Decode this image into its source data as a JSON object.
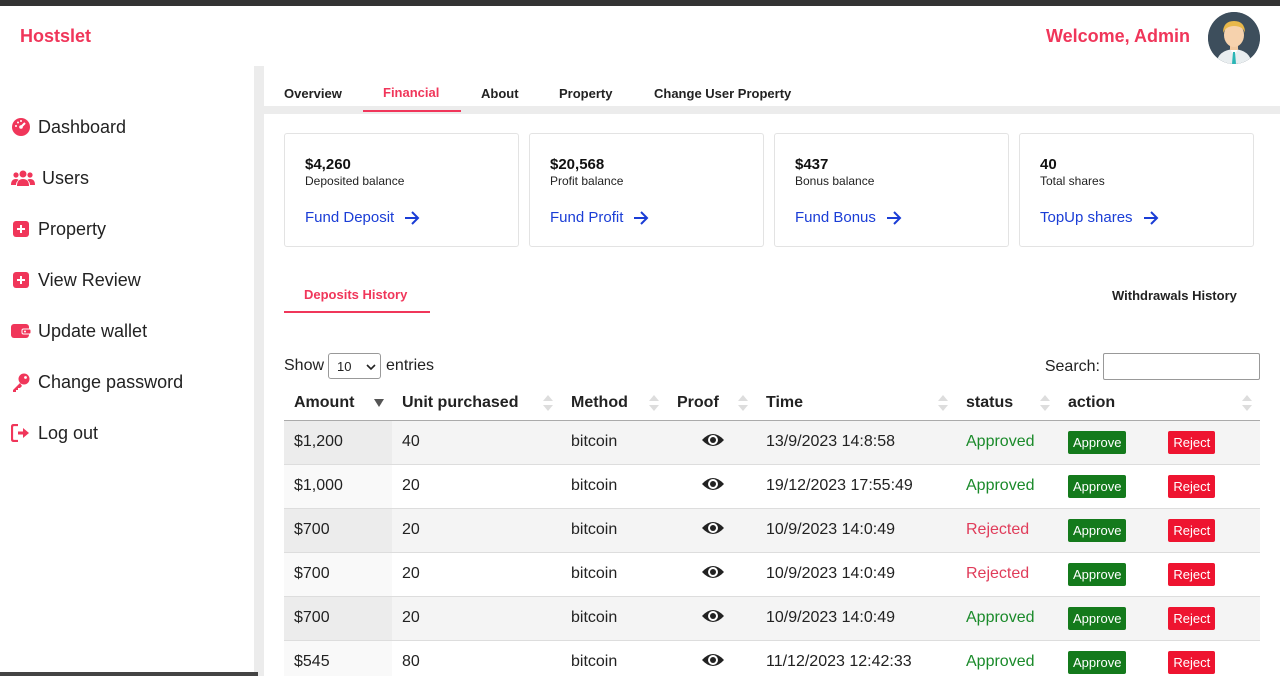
{
  "header": {
    "brand": "Hostslet",
    "welcome": "Welcome, Admin"
  },
  "sidebar": {
    "items": [
      {
        "label": "Dashboard",
        "icon": "dashboard-icon"
      },
      {
        "label": "Users",
        "icon": "users-icon"
      },
      {
        "label": "Property",
        "icon": "plus-square-icon"
      },
      {
        "label": "View Review",
        "icon": "plus-square-icon"
      },
      {
        "label": "Update wallet",
        "icon": "wallet-icon"
      },
      {
        "label": "Change password",
        "icon": "key-icon"
      },
      {
        "label": "Log out",
        "icon": "logout-icon"
      }
    ]
  },
  "tabs": [
    "Overview",
    "Financial",
    "About",
    "Property",
    "Change User Property"
  ],
  "active_tab": "Financial",
  "cards": [
    {
      "amount": "$4,260",
      "label": "Deposited balance",
      "link": "Fund Deposit"
    },
    {
      "amount": "$20,568",
      "label": "Profit balance",
      "link": "Fund Profit"
    },
    {
      "amount": "$437",
      "label": "Bonus balance",
      "link": "Fund Bonus"
    },
    {
      "amount": "40",
      "label": "Total shares",
      "link": "TopUp shares"
    }
  ],
  "history_tabs": {
    "deposits": "Deposits History",
    "withdrawals": "Withdrawals History"
  },
  "table_controls": {
    "show": "Show",
    "entries": "entries",
    "page_size": "10",
    "search_label": "Search:"
  },
  "table": {
    "headers": [
      "Amount",
      "Unit purchased",
      "Method",
      "Proof",
      "Time",
      "status",
      "action"
    ],
    "approve_label": "Approve",
    "reject_label": "Reject",
    "rows": [
      {
        "amount": "$1,200",
        "units": "40",
        "method": "bitcoin",
        "time": "13/9/2023 14:8:58",
        "status": "Approved"
      },
      {
        "amount": "$1,000",
        "units": "20",
        "method": "bitcoin",
        "time": "19/12/2023 17:55:49",
        "status": "Approved"
      },
      {
        "amount": "$700",
        "units": "20",
        "method": "bitcoin",
        "time": "10/9/2023 14:0:49",
        "status": "Rejected"
      },
      {
        "amount": "$700",
        "units": "20",
        "method": "bitcoin",
        "time": "10/9/2023 14:0:49",
        "status": "Rejected"
      },
      {
        "amount": "$700",
        "units": "20",
        "method": "bitcoin",
        "time": "10/9/2023 14:0:49",
        "status": "Approved"
      },
      {
        "amount": "$545",
        "units": "80",
        "method": "bitcoin",
        "time": "11/12/2023 12:42:33",
        "status": "Approved"
      }
    ]
  },
  "colors": {
    "accent": "#f0365a",
    "link": "#1a3dd6",
    "approve": "#147a1c",
    "reject": "#ee1430",
    "approved_text": "#1a8a2a",
    "rejected_text": "#e03c5a"
  }
}
